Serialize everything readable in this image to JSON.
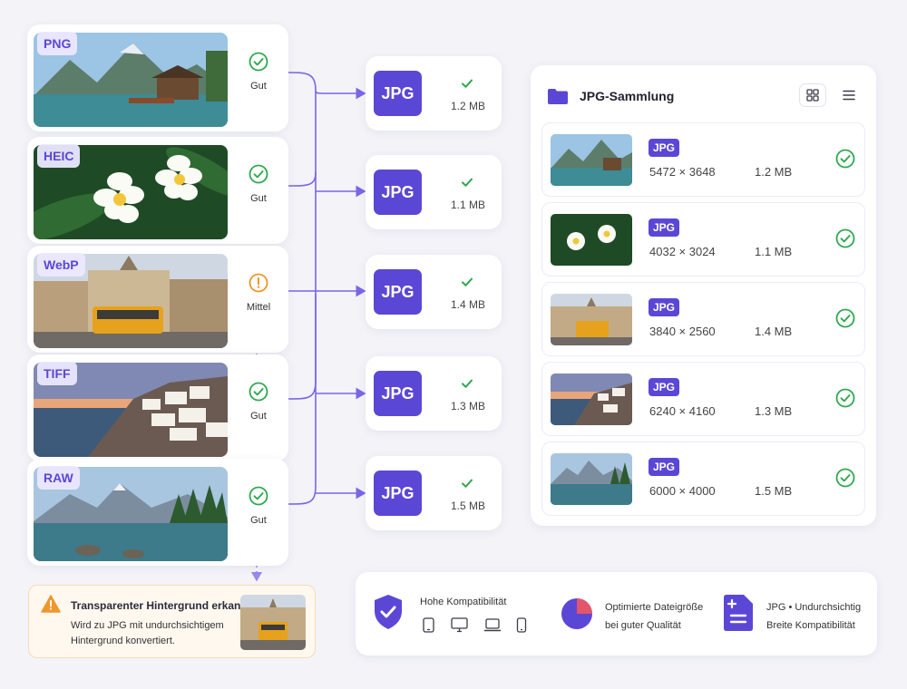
{
  "sources": [
    {
      "format": "PNG",
      "status": "Gut",
      "status_type": "ok",
      "scene": "mountain-lake-cabin"
    },
    {
      "format": "HEIC",
      "status": "Gut",
      "status_type": "ok",
      "scene": "white-flowers"
    },
    {
      "format": "WebP",
      "status": "Mittel",
      "status_type": "warning",
      "scene": "city-tram"
    },
    {
      "format": "TIFF",
      "status": "Gut",
      "status_type": "ok",
      "scene": "coastal-village-sunset"
    },
    {
      "format": "RAW",
      "status": "Gut",
      "status_type": "ok",
      "scene": "alpine-lake-forest"
    }
  ],
  "outputs": [
    {
      "label": "JPG",
      "size": "1.2 MB"
    },
    {
      "label": "JPG",
      "size": "1.1 MB"
    },
    {
      "label": "JPG",
      "size": "1.4 MB"
    },
    {
      "label": "JPG",
      "size": "1.3 MB"
    },
    {
      "label": "JPG",
      "size": "1.5 MB"
    }
  ],
  "collection": {
    "title": "JPG-Sammlung",
    "icons": {
      "folder": "folder-icon",
      "grid": "grid-view-icon",
      "list": "list-view-icon"
    },
    "items": [
      {
        "badge": "JPG",
        "dims": "5472 × 3648",
        "size": "1.2 MB"
      },
      {
        "badge": "JPG",
        "dims": "4032 × 3024",
        "size": "1.1 MB"
      },
      {
        "badge": "JPG",
        "dims": "3840 × 2560",
        "size": "1.4 MB"
      },
      {
        "badge": "JPG",
        "dims": "6240 × 4160",
        "size": "1.3 MB"
      },
      {
        "badge": "JPG",
        "dims": "6000 × 4000",
        "size": "1.5 MB"
      }
    ]
  },
  "alert": {
    "title": "Transparenter Hintergrund erkannt",
    "body": "Wird zu JPG mit undurchsichtigem Hintergrund konvertiert."
  },
  "features": [
    {
      "icon": "shield-check-icon",
      "line1": "Hohe Kompatibilität",
      "line2": ""
    },
    {
      "icon": "pie-chart-icon",
      "line1": "Optimierte Dateigröße",
      "line2": "bei guter Qualität"
    },
    {
      "icon": "document-icon",
      "line1": "JPG • Undurchsichtig",
      "line2": "Breite Kompatibilität"
    }
  ],
  "devices": [
    "tablet-icon",
    "monitor-icon",
    "laptop-icon",
    "phone-icon"
  ],
  "colors": {
    "accent": "#5b47d6",
    "ok": "#2fa84f",
    "warning": "#f0962a",
    "background": "#f3f3f8"
  }
}
